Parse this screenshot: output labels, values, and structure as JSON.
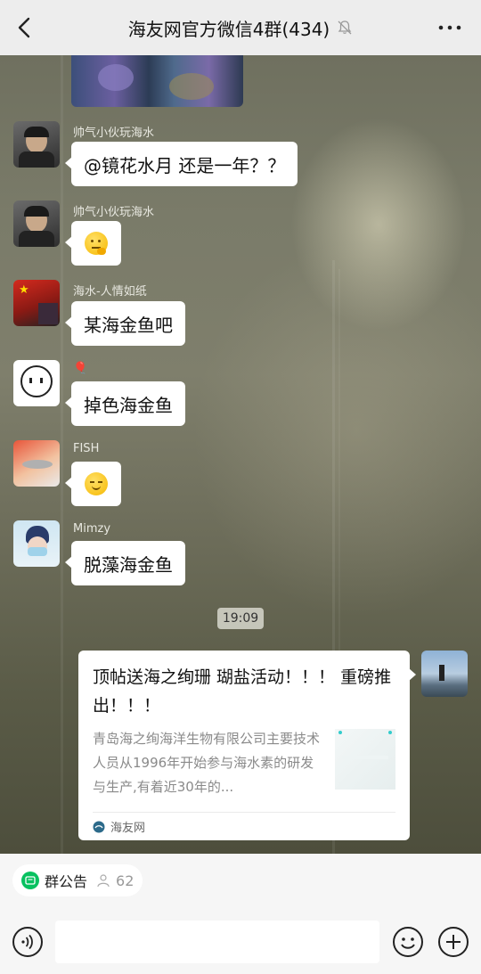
{
  "header": {
    "title": "海友网官方微信4群(434)"
  },
  "messages": [
    {
      "sender": "帅气小伙玩海水",
      "text": "@镜花水月  还是一年？？"
    },
    {
      "sender": "帅气小伙玩海水",
      "emoji": "thinking-face-emoji"
    },
    {
      "sender": "海水-人情如纸",
      "text": "某海金鱼吧"
    },
    {
      "sender": "🎈",
      "text": "掉色海金鱼"
    },
    {
      "sender": "FISH",
      "emoji": "smile-face-emoji"
    },
    {
      "sender": "Mimzy",
      "text": "脱藻海金鱼"
    }
  ],
  "timestamp": "19:09",
  "card": {
    "title": "顶帖送海之绚珊 瑚盐活动！！！ 重磅推出！！！",
    "description": "青岛海之绚海洋生物有限公司主要技术人员从1996年开始参与海水素的研发与生产,有着近30年的...",
    "source": "海友网"
  },
  "bottom": {
    "notice_label": "群公告",
    "member_count": "62"
  },
  "colors": {
    "header_bg": "#ededed",
    "bubble_bg": "#ffffff",
    "accent_green": "#07c160"
  }
}
